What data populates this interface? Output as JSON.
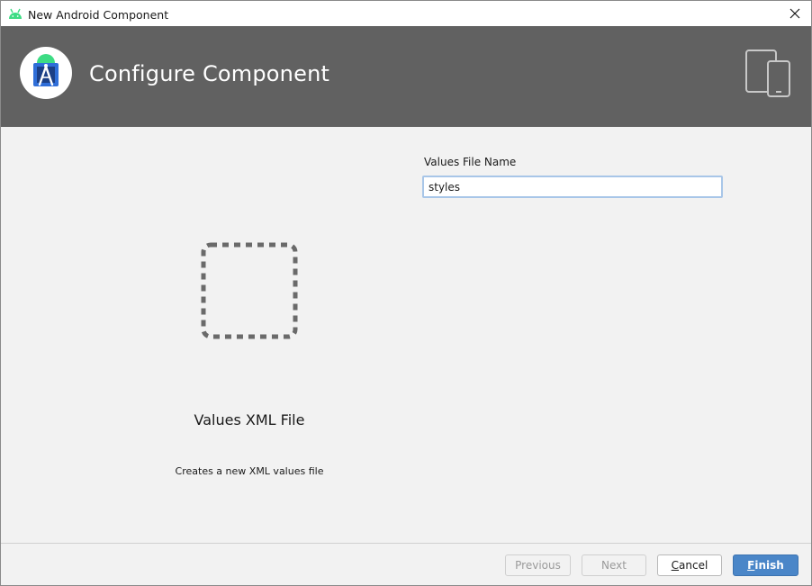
{
  "window": {
    "title": "New Android Component",
    "icon": "android-icon",
    "close_icon": "close-icon"
  },
  "banner": {
    "heading": "Configure Component",
    "logo": "android-studio-logo",
    "devices_icon": "devices-icon",
    "background": "#616161"
  },
  "preview": {
    "icon": "dashed-square-icon",
    "name": "Values XML File",
    "description": "Creates a new XML values file"
  },
  "form": {
    "values_file_name": {
      "label": "Values File Name",
      "value": "styles"
    }
  },
  "footer": {
    "previous": "Previous",
    "next": "Next",
    "cancel": {
      "mnemonic": "C",
      "rest": "ancel"
    },
    "finish": {
      "mnemonic": "F",
      "rest": "inish"
    }
  },
  "colors": {
    "accent": "#4a86c8",
    "android_green": "#3ddc84"
  }
}
